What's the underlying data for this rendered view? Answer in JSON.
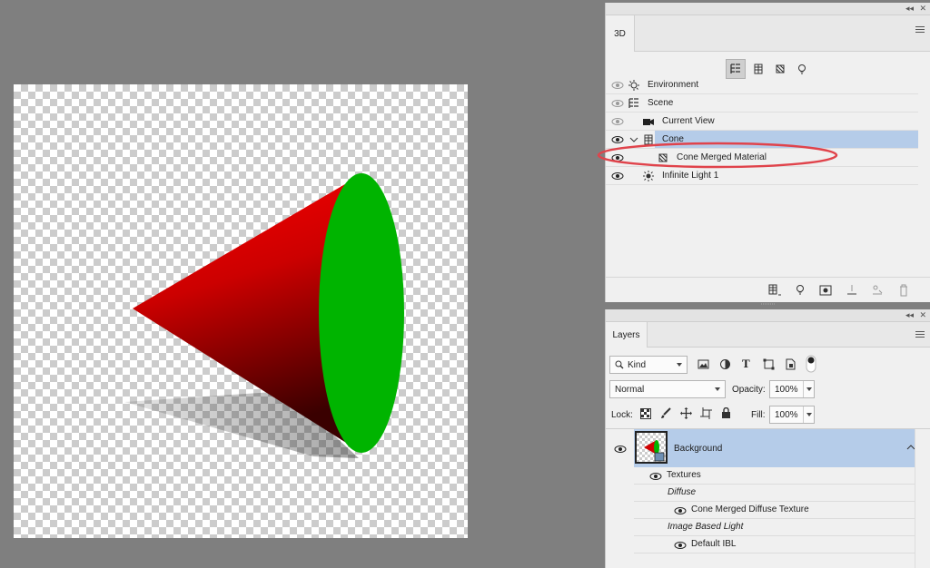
{
  "panel3d": {
    "tab_label": "3D",
    "tree": [
      {
        "label": "Environment",
        "icon": "environment-icon"
      },
      {
        "label": "Scene",
        "icon": "scene-icon"
      },
      {
        "label": "Current View",
        "icon": "camera-icon"
      },
      {
        "label": "Cone",
        "icon": "mesh-icon",
        "selected": true,
        "expanded": true
      },
      {
        "label": "Cone Merged Material",
        "icon": "material-icon"
      },
      {
        "label": "Infinite Light 1",
        "icon": "light-icon"
      }
    ]
  },
  "layers": {
    "tab_label": "Layers",
    "filter_kind": "Kind",
    "blend_mode": "Normal",
    "opacity_label": "Opacity:",
    "opacity_value": "100%",
    "lock_label": "Lock:",
    "fill_label": "Fill:",
    "fill_value": "100%",
    "layer_name": "Background",
    "sub_items": {
      "textures": "Textures",
      "diffuse": "Diffuse",
      "diffuse_texture": "Cone Merged Diffuse Texture",
      "ibl": "Image Based Light",
      "default_ibl": "Default IBL"
    }
  },
  "colors": {
    "selection": "#b5cce9",
    "annotation": "#e0434b",
    "cone_red": "#e60000",
    "cone_green": "#00b400"
  }
}
